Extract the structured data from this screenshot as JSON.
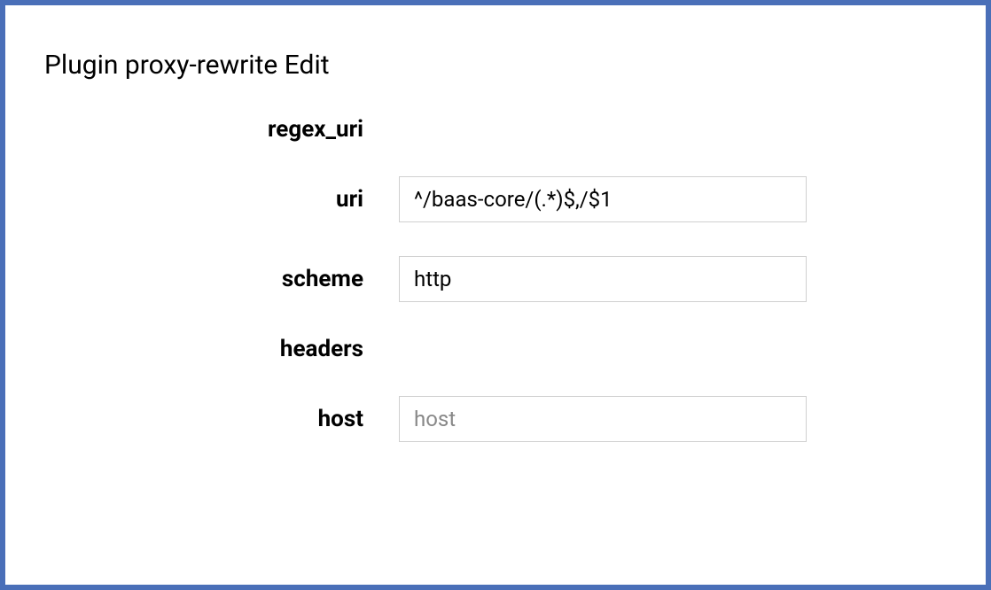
{
  "title": "Plugin proxy-rewrite Edit",
  "form": {
    "regex_uri": {
      "label": "regex_uri"
    },
    "uri": {
      "label": "uri",
      "value": "^/baas-core/(.*)$,/$1"
    },
    "scheme": {
      "label": "scheme",
      "value": "http"
    },
    "headers": {
      "label": "headers"
    },
    "host": {
      "label": "host",
      "value": "",
      "placeholder": "host"
    }
  }
}
